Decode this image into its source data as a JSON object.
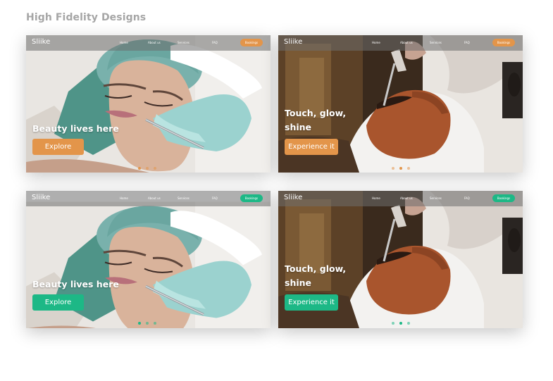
{
  "page": {
    "title": "High Fidelity Designs"
  },
  "colors": {
    "orange": "#E3954A",
    "green": "#1DB886"
  },
  "cards": [
    {
      "logo": "Sliike",
      "nav": [
        "Home",
        "About us",
        "Services",
        "FAQ"
      ],
      "button": "Bookings",
      "headline": "Beauty lives here",
      "cta": "Explore",
      "accent": "orange"
    },
    {
      "logo": "Sliike",
      "nav": [
        "Home",
        "About us",
        "Services",
        "FAQ"
      ],
      "button": "Bookings",
      "headline_line1": "Touch, glow,",
      "headline_line2": "shine",
      "cta": "Experience it",
      "accent": "orange"
    },
    {
      "logo": "Sliike",
      "nav": [
        "Home",
        "About us",
        "Services",
        "FAQ"
      ],
      "button": "Bookings",
      "headline": "Beauty lives here",
      "cta": "Explore",
      "accent": "green"
    },
    {
      "logo": "Sliike",
      "nav": [
        "Home",
        "About us",
        "Services",
        "FAQ"
      ],
      "button": "Bookings",
      "headline_line1": "Touch, glow,",
      "headline_line2": "shine",
      "cta": "Experience it",
      "accent": "green"
    }
  ]
}
